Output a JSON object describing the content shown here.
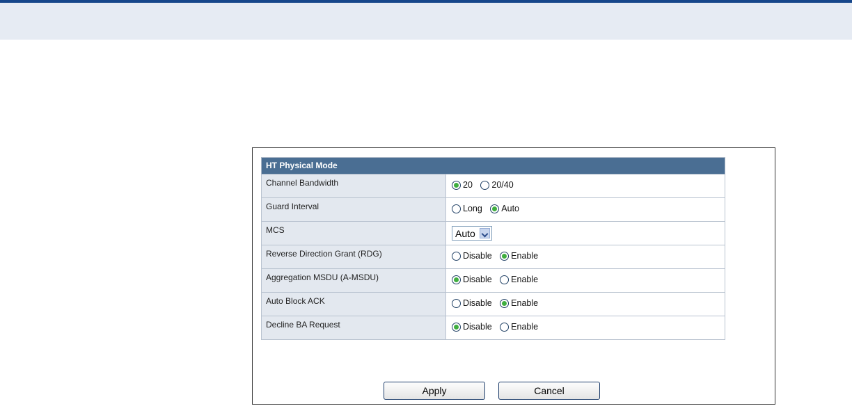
{
  "section_title": "HT Physical Mode",
  "rows": {
    "channel_bandwidth": {
      "label": "Channel Bandwidth",
      "options": [
        {
          "label": "20",
          "selected": true
        },
        {
          "label": "20/40",
          "selected": false
        }
      ]
    },
    "guard_interval": {
      "label": "Guard Interval",
      "options": [
        {
          "label": "Long",
          "selected": false
        },
        {
          "label": "Auto",
          "selected": true
        }
      ]
    },
    "mcs": {
      "label": "MCS",
      "selected_value": "Auto"
    },
    "rdg": {
      "label": "Reverse Direction Grant (RDG)",
      "options": [
        {
          "label": "Disable",
          "selected": false
        },
        {
          "label": "Enable",
          "selected": true
        }
      ]
    },
    "amsdu": {
      "label": "Aggregation MSDU (A-MSDU)",
      "options": [
        {
          "label": "Disable",
          "selected": true
        },
        {
          "label": "Enable",
          "selected": false
        }
      ]
    },
    "auto_block_ack": {
      "label": "Auto Block ACK",
      "options": [
        {
          "label": "Disable",
          "selected": false
        },
        {
          "label": "Enable",
          "selected": true
        }
      ]
    },
    "decline_ba": {
      "label": "Decline BA Request",
      "options": [
        {
          "label": "Disable",
          "selected": true
        },
        {
          "label": "Enable",
          "selected": false
        }
      ]
    }
  },
  "buttons": {
    "apply": "Apply",
    "cancel": "Cancel"
  },
  "colors": {
    "header_bar": "#16468a",
    "section_header": "#4a6e93",
    "label_bg": "#e3e8ef",
    "radio_selected": "#3fae3f"
  }
}
